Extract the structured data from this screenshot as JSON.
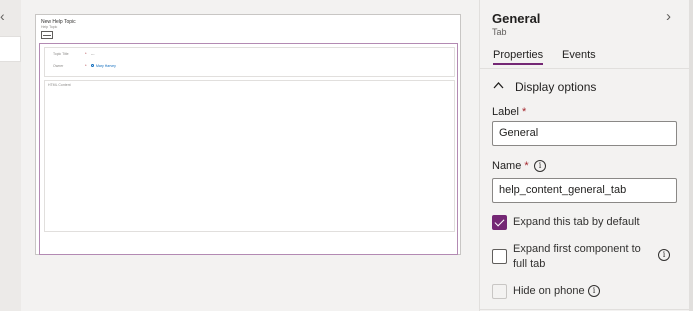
{
  "form": {
    "title": "New Help Topic",
    "subtitle": "Help Topic",
    "fields": [
      {
        "label": "Topic Title",
        "required": "*",
        "value": "---"
      },
      {
        "label": "Owner",
        "required": "*",
        "value": "Mary Harvey"
      }
    ],
    "html_content_label": "HTML Content"
  },
  "panel": {
    "title": "General",
    "subtitle": "Tab",
    "tabs": [
      "Properties",
      "Events"
    ],
    "section_title": "Display options",
    "label_field": {
      "label": "Label",
      "required": "*",
      "value": "General"
    },
    "name_field": {
      "label": "Name",
      "required": "*",
      "value": "help_content_general_tab",
      "info_icon": "info-icon"
    },
    "checkboxes": [
      {
        "label": "Expand this tab by default",
        "checked": true
      },
      {
        "label": "Expand first component to full tab",
        "line1": "Expand first component to",
        "line2": "full tab",
        "checked": false
      },
      {
        "label": "Hide on phone",
        "checked": false,
        "disabled": true
      }
    ]
  },
  "colors": {
    "accent": "#742774",
    "required": "#a4262c",
    "link": "#0f6cbd"
  },
  "icons": {
    "back": "chevron-left-icon",
    "close": "chevron-right-icon",
    "collapse": "chevron-up-icon"
  }
}
